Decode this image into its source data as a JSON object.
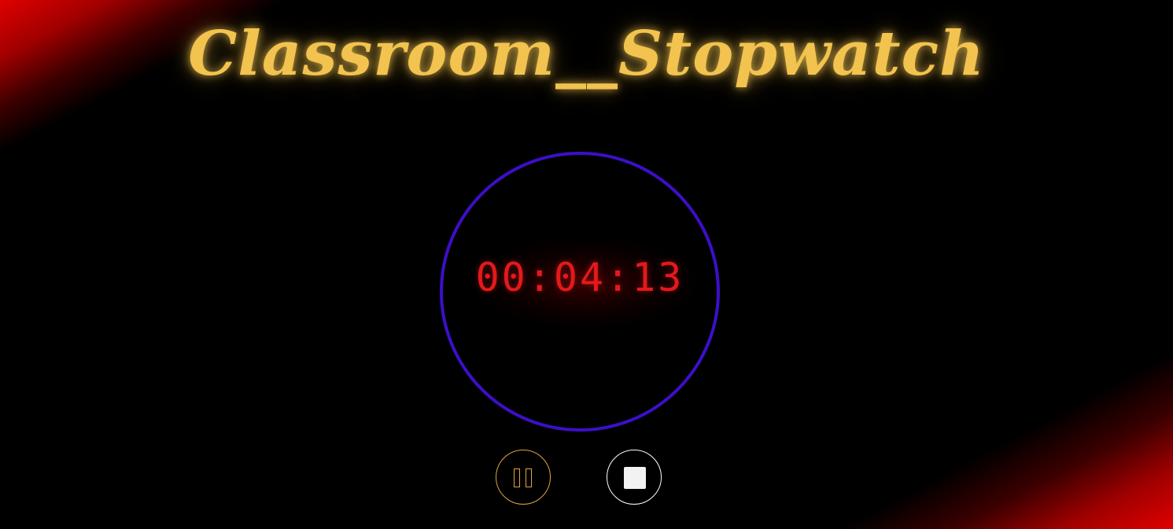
{
  "app": {
    "title": "Classroom__Stopwatch"
  },
  "stopwatch": {
    "display_time": "00:04:13"
  },
  "controls": {
    "pause_icon": "pause-icon",
    "stop_icon": "stop-icon"
  },
  "colors": {
    "title": "#f2c34f",
    "dial_ring": "#3c0fc8",
    "time_text": "#e4191b",
    "pause_button": "#e0a73c",
    "stop_button": "#ffffff",
    "corner_accent": "#e00000",
    "background": "#000000"
  }
}
